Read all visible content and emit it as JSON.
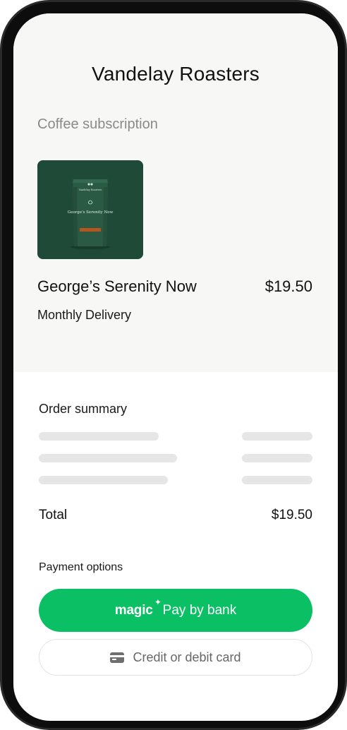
{
  "store": {
    "title": "Vandelay Roasters"
  },
  "product": {
    "category": "Coffee subscription",
    "name": "George’s Serenity Now",
    "price": "$19.50",
    "frequency": "Monthly Delivery",
    "bag_label": "George's Serenity Now",
    "bag_brand": "Vandelay Roasters"
  },
  "summary": {
    "label": "Order summary",
    "total_label": "Total",
    "total_value": "$19.50"
  },
  "payment": {
    "label": "Payment options",
    "magic_brand": "magic",
    "magic_sparkle": "✦",
    "magic_label": "Pay by bank",
    "card_label": "Credit or debit card"
  },
  "colors": {
    "accent": "#0bbf64",
    "top_background": "#f7f7f5",
    "product_background": "#1f4a37",
    "skeleton": "#e6e6e6"
  }
}
